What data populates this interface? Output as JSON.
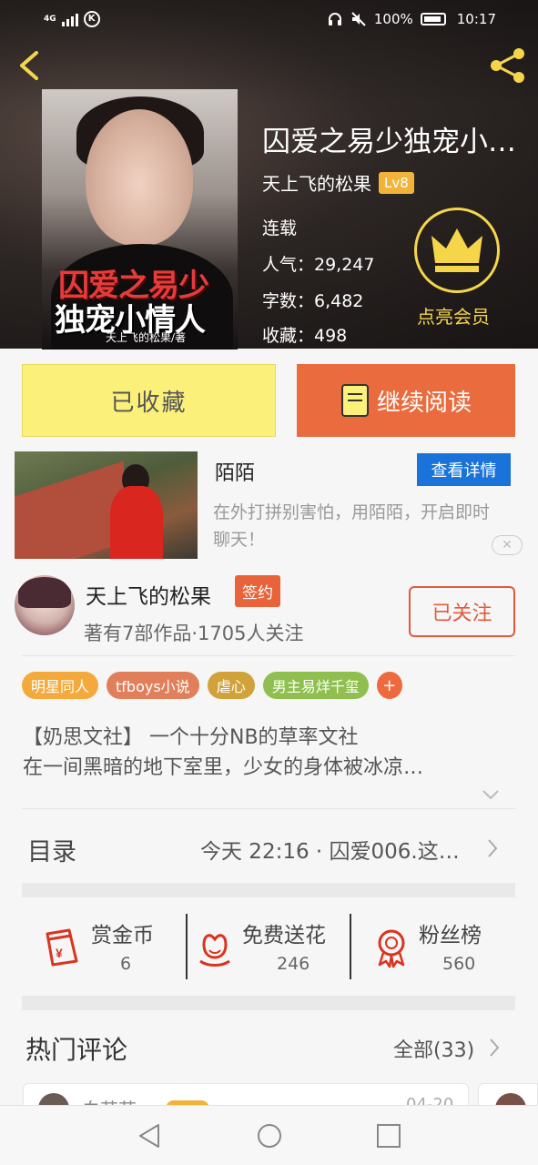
{
  "status_bar": {
    "network": "4G",
    "battery": "100%",
    "time": "10:17"
  },
  "book": {
    "title": "囚爱之易少独宠小…",
    "cover_title_line1": "囚爱之易少",
    "cover_title_line2": "独宠小情人",
    "cover_author": "天上飞的松果/著",
    "author": "天上飞的松果",
    "level": "Lv8",
    "status": "连载",
    "popularity": "人气：29,247",
    "word_count": "字数：6,482",
    "favorites": "收藏：498",
    "vip_label": "点亮会员"
  },
  "actions": {
    "collected_label": "已收藏",
    "continue_label": "继续阅读"
  },
  "ad": {
    "title": "陌陌",
    "detail_button": "查看详情",
    "description": "在外打拼别害怕，用陌陌，开启即时聊天！",
    "close_icon": "✕"
  },
  "author_card": {
    "name": "天上飞的松果",
    "badge": "签约",
    "stats": "著有7部作品·1705人关注",
    "follow_label": "已关注"
  },
  "tags": [
    {
      "label": "明星同人",
      "color": "#f3a93c"
    },
    {
      "label": "tfboys小说",
      "color": "#e07f5a"
    },
    {
      "label": "虐心",
      "color": "#d2a23a"
    },
    {
      "label": "男主易烊千玺",
      "color": "#8fbf4f"
    },
    {
      "label": "+",
      "color": "#ee6a3e"
    }
  ],
  "intro": {
    "line1": "【奶思文社】 一个十分NB的草率文社",
    "line2": "在一间黑暗的地下室里，少女的身体被冰凉…"
  },
  "catalog": {
    "label": "目录",
    "latest": "今天 22:16 · 囚爱006.这…"
  },
  "rewards": [
    {
      "label": "赏金币",
      "value": "6",
      "icon": "red-envelope-icon"
    },
    {
      "label": "免费送花",
      "value": "246",
      "icon": "flower-icon"
    },
    {
      "label": "粉丝榜",
      "value": "560",
      "icon": "medal-icon"
    }
  ],
  "comments": {
    "title": "热门评论",
    "all_label": "全部(33)",
    "partial_user": "白若若",
    "partial_date": "04-20"
  },
  "colors": {
    "accent_orange": "#ea6b3d",
    "collected_yellow": "#fbf07a",
    "vip_gold": "#f5d64b",
    "ad_blue": "#1a73d9"
  }
}
